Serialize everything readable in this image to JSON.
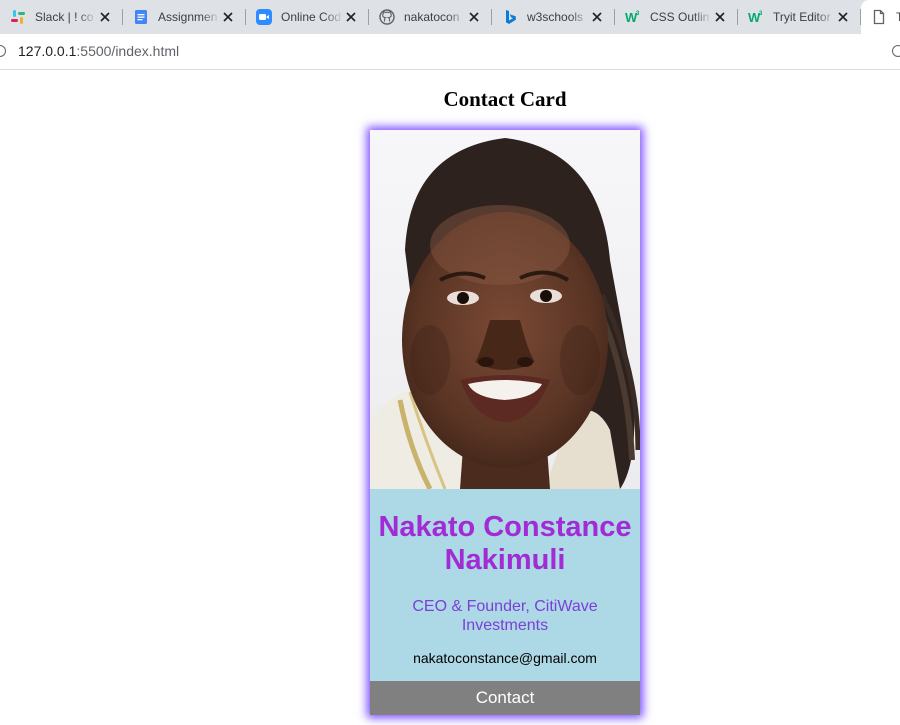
{
  "browser": {
    "tabs": [
      {
        "title": "Slack | ! co",
        "icon": "slack-icon"
      },
      {
        "title": "Assignmen",
        "icon": "google-docs-icon"
      },
      {
        "title": "Online Cod",
        "icon": "zoom-icon"
      },
      {
        "title": "nakatocon",
        "icon": "github-icon"
      },
      {
        "title": "w3schools",
        "icon": "bing-icon"
      },
      {
        "title": "CSS Outlin",
        "icon": "w3schools-icon"
      },
      {
        "title": "Tryit Editor",
        "icon": "w3schools-icon"
      },
      {
        "title": "T",
        "icon": "page-icon",
        "active": true
      }
    ],
    "url_host": "127.0.0.1",
    "url_path": ":5500/index.html"
  },
  "page": {
    "heading": "Contact Card"
  },
  "card": {
    "photo": "profile-photo",
    "name": "Nakato Constance Nakimuli",
    "role": "CEO & Founder, CitiWave Investments",
    "email": "nakatoconstance@gmail.com",
    "button_label": "Contact",
    "colors": {
      "card_background": "#add8e6",
      "name": "#a22bd6",
      "role": "#7b3fd8",
      "button_background": "#808080",
      "shadow": "#7c4dff"
    }
  }
}
